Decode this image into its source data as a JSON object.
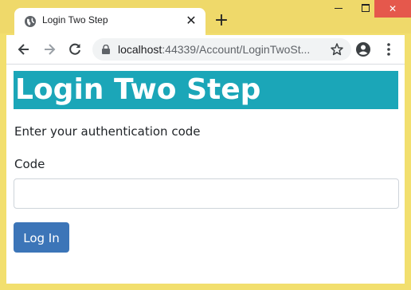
{
  "browser": {
    "tab_title": "Login Two Step",
    "url_host": "localhost",
    "url_rest": ":44339/Account/LoginTwoSt...",
    "icons": {
      "tab": "globe-icon",
      "close_tab": "close-icon",
      "new_tab": "plus-icon",
      "back": "back-arrow-icon",
      "forward": "forward-arrow-icon",
      "reload": "reload-icon",
      "lock": "lock-icon",
      "bookmark": "star-icon",
      "profile": "account-icon",
      "menu": "kebab-menu-icon"
    }
  },
  "page": {
    "heading": "Login Two Step",
    "instruction": "Enter your authentication code",
    "code_label": "Code",
    "code_value": "",
    "submit_label": "Log In"
  },
  "colors": {
    "heading_bg": "#1ba6b8",
    "button_bg": "#3c75b8",
    "window_frame": "#efd96a",
    "close_button": "#e5584c"
  }
}
